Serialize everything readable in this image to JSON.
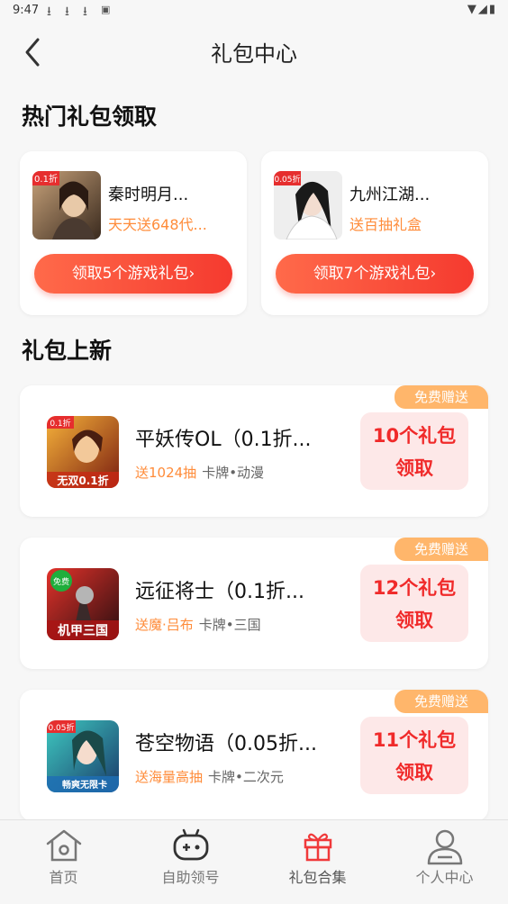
{
  "status": {
    "time": "9:47"
  },
  "nav": {
    "title": "礼包中心"
  },
  "hot_section": {
    "title": "热门礼包领取"
  },
  "hot_items": [
    {
      "name": "秦时明月...",
      "desc": "天天送648代...",
      "button": "领取5个游戏礼包›",
      "badge": "0.1折"
    },
    {
      "name": "九州江湖...",
      "desc": "送百抽礼盒",
      "button": "领取7个游戏礼包›",
      "badge": "0.05折"
    }
  ],
  "new_section": {
    "title": "礼包上新"
  },
  "new_items": [
    {
      "badge": "免费赠送",
      "name": "平妖传OL（0.1折...",
      "gift": "送1024抽",
      "category": "卡牌•动漫",
      "claim_line1": "10个礼包",
      "claim_line2": "领取",
      "icon_text": "0.1折",
      "icon_caption": "无双0.1折"
    },
    {
      "badge": "免费赠送",
      "name": "远征将士（0.1折...",
      "gift": "送魔·吕布",
      "category": "卡牌•三国",
      "claim_line1": "12个礼包",
      "claim_line2": "领取",
      "icon_text": "免费",
      "icon_caption": "机甲三国"
    },
    {
      "badge": "免费赠送",
      "name": "苍空物语（0.05折...",
      "gift": "送海量高抽",
      "category": "卡牌•二次元",
      "claim_line1": "11个礼包",
      "claim_line2": "领取",
      "icon_text": "0.05折",
      "icon_caption": "畅爽无限卡"
    }
  ],
  "tabbar": {
    "items": [
      {
        "label": "首页",
        "icon": "home-icon"
      },
      {
        "label": "自助领号",
        "icon": "gamepad-icon"
      },
      {
        "label": "礼包合集",
        "icon": "gift-icon"
      },
      {
        "label": "个人中心",
        "icon": "user-icon"
      }
    ],
    "active_index": 2
  },
  "colors": {
    "accent": "#f53a2f",
    "orange": "#ff8c3a",
    "badge": "#ffb66b"
  }
}
